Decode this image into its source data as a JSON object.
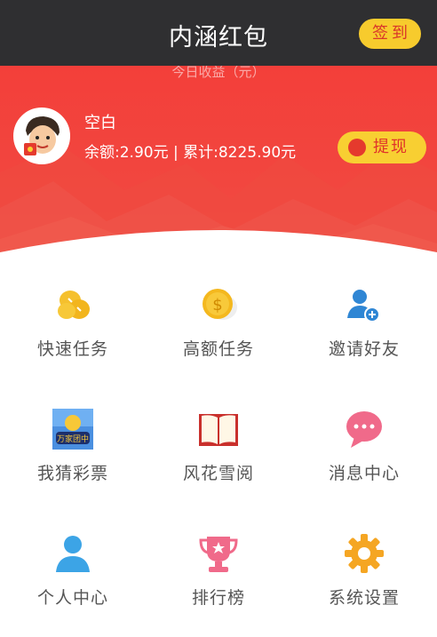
{
  "header": {
    "title": "内涵红包",
    "signin_label": "签到"
  },
  "profile": {
    "today_earnings_label": "今日收益（元）",
    "username": "空白",
    "balance_text": "余额:2.90元 | 累计:8225.90元",
    "withdraw_label": "提现"
  },
  "menu": [
    {
      "label": "快速任务",
      "icon": "coins-icon"
    },
    {
      "label": "高额任务",
      "icon": "dollar-coin-icon"
    },
    {
      "label": "邀请好友",
      "icon": "add-user-icon"
    },
    {
      "label": "我猜彩票",
      "icon": "lottery-icon",
      "icon_text": "万家团中"
    },
    {
      "label": "风花雪阅",
      "icon": "book-icon"
    },
    {
      "label": "消息中心",
      "icon": "message-bubble-icon"
    },
    {
      "label": "个人中心",
      "icon": "person-icon"
    },
    {
      "label": "排行榜",
      "icon": "trophy-icon"
    },
    {
      "label": "系统设置",
      "icon": "gear-icon"
    }
  ],
  "colors": {
    "topbar": "#2f2f31",
    "hero_red": "#f33f3a",
    "accent_yellow": "#f7cb2d",
    "accent_red": "#e0332a"
  }
}
